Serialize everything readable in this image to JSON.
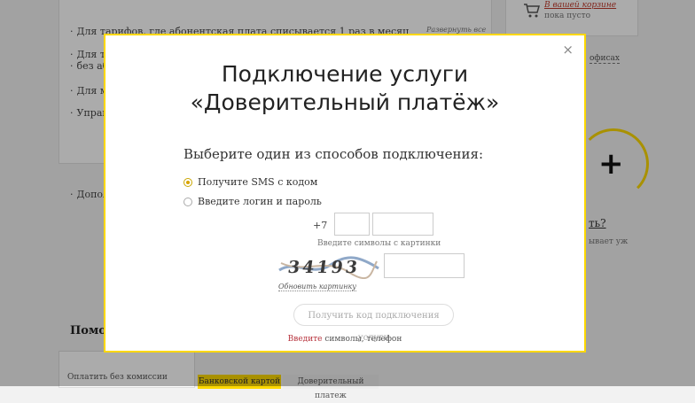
{
  "background": {
    "lines": [
      "Для тарифов, где абонентская плата списывается 1 раз в месяц",
      "Для тариф",
      "без абон",
      "Для мод",
      "Управл",
      "Дополн"
    ],
    "expand_link": "Развернуть все",
    "cart": {
      "title": "В вашей корзине",
      "status": "пока пусто"
    },
    "offices_link": "офисах",
    "question_text": "ть?",
    "question_sub": "ывает уж",
    "section_heading": "Помо",
    "pay_text": "Оплатить без комиссии",
    "tabs": [
      "Банковской картой",
      "Доверительный платеж"
    ]
  },
  "modal": {
    "title_line1": "Подключение услуги",
    "title_line2": "«Доверительный платёж»",
    "choose_label": "Выберите один из способов подключения:",
    "options": [
      {
        "label": "Получите SMS с кодом",
        "selected": true
      },
      {
        "label": "Введите логин и пароль",
        "selected": false
      }
    ],
    "phone_prefix": "+7",
    "phone_code_value": "",
    "phone_number_value": "",
    "captcha_hint": "Введите символы с картинки",
    "captcha_text": "34193",
    "captcha_refresh": "Обновить картинку",
    "captcha_input_value": "",
    "submit_label": "Получить код подключения услуги",
    "error_red": "Введите",
    "error_rest": " символы, телефон",
    "close_glyph": "×"
  },
  "colors": {
    "accent": "#fcd800",
    "error": "#b7323c"
  }
}
